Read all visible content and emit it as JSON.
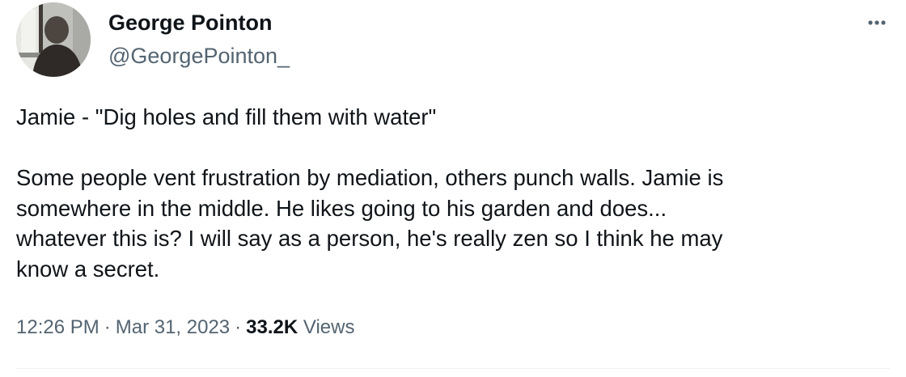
{
  "author": {
    "display_name": "George Pointon",
    "handle": "@GeorgePointon_",
    "avatar_icon": "profile-photo-silhouette"
  },
  "more_icon": "more-horizontal-icon",
  "tweet": {
    "lines": [
      "Jamie - \"Dig holes and fill them with water\"",
      "",
      "Some people vent frustration by mediation, others punch walls. Jamie is",
      "somewhere in the middle. He likes going to his garden and does...",
      "whatever this is? I will say as a person, he's really zen so I think he may",
      "know a secret."
    ]
  },
  "meta": {
    "time": "12:26 PM",
    "separator": "·",
    "date": "Mar 31, 2023",
    "views_count": "33.2K",
    "views_label": "Views"
  },
  "colors": {
    "primary_text": "#0f1419",
    "secondary_text": "#536471",
    "divider": "#eff3f4"
  }
}
